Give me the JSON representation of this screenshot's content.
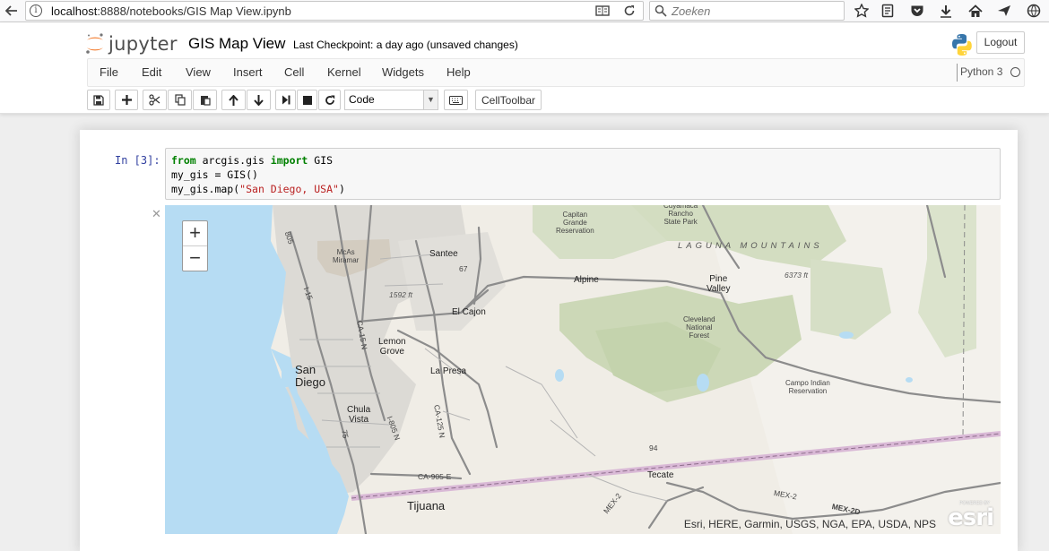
{
  "browser": {
    "url_host": "localhost",
    "url_rest": ":8888/notebooks/GIS Map View.ipynb",
    "search_placeholder": "Zoeken"
  },
  "header": {
    "logo_text": "jupyter",
    "notebook_title": "GIS Map View",
    "checkpoint": "Last Checkpoint: a day ago (unsaved changes)",
    "logout_label": "Logout"
  },
  "menu": {
    "items": [
      "File",
      "Edit",
      "View",
      "Insert",
      "Cell",
      "Kernel",
      "Widgets",
      "Help"
    ],
    "kernel_name": "Python 3"
  },
  "toolbar": {
    "cell_type": "Code",
    "celltoolbar_label": "CellToolbar"
  },
  "cell": {
    "prompt": "In [3]:",
    "code_lines": [
      {
        "parts": [
          {
            "t": "from",
            "c": "kw"
          },
          {
            "t": " arcgis.gis ",
            "c": ""
          },
          {
            "t": "import",
            "c": "kw"
          },
          {
            "t": " GIS",
            "c": ""
          }
        ]
      },
      {
        "parts": [
          {
            "t": "my_gis = GIS()",
            "c": ""
          }
        ]
      },
      {
        "parts": [
          {
            "t": "my_gis.map(",
            "c": ""
          },
          {
            "t": "\"San Diego, USA\"",
            "c": "str"
          },
          {
            "t": ")",
            "c": ""
          }
        ]
      }
    ]
  },
  "map": {
    "zoom_in": "+",
    "zoom_out": "−",
    "attribution": "Esri, HERE, Garmin, USGS, NGA, EPA, USDA, NPS",
    "esri_logo": "esri",
    "esri_powered": "POWERED BY",
    "labels": {
      "capitan_grande": "Capitan\nGrande\nReservation",
      "cuyamaca": "Cuyamaca\nRancho\nState Park",
      "laguna_mountains": "LAGUNA MOUNTAINS",
      "mcas_miramar": "McAs\nMiramar",
      "santee": "Santee",
      "alpine": "Alpine",
      "pine_valley": "Pine\nValley",
      "elev_6373": "6373 ft",
      "elev_1592": "1592 ft",
      "el_cajon": "El Cajon",
      "cleveland_nf": "Cleveland\nNational\nForest",
      "lemon_grove": "Lemon\nGrove",
      "san_diego": "San\nDiego",
      "la_presa": "La Presa",
      "campo": "Campo Indian\nReservation",
      "chula_vista": "Chula\nVista",
      "tecate": "Tecate",
      "tijuana": "Tijuana",
      "ca_905": "CA-905-E",
      "mex_2": "MEX-2",
      "mex_2d": "MEX-2D",
      "mex_2_b": "MEX-2",
      "rt_94": "94",
      "rt_67": "67",
      "i_805": "805",
      "i_805_n": "I-805 N",
      "ca_125": "CA-125 N",
      "ca_15": "CA-15 N",
      "rt_75": "75",
      "i_15": "I-15"
    }
  }
}
